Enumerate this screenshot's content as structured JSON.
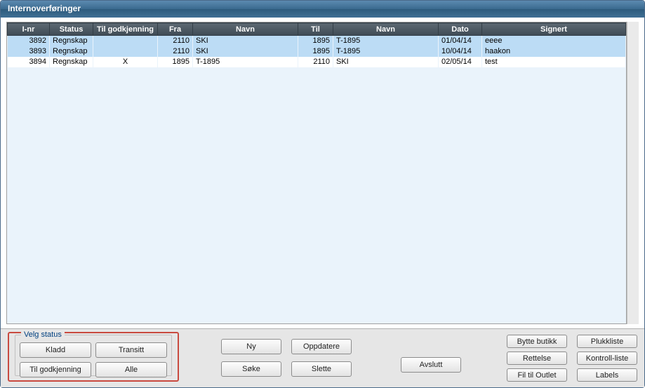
{
  "window": {
    "title": "Internoverføringer"
  },
  "grid": {
    "headers": [
      "I-nr",
      "Status",
      "Til godkjenning",
      "Fra",
      "Navn",
      "Til",
      "Navn",
      "Dato",
      "Signert"
    ],
    "rows": [
      {
        "inr": "3892",
        "status": "Regnskap",
        "tg": "",
        "fra": "2110",
        "navn1": "SKI",
        "til": "1895",
        "navn2": "T-1895",
        "dato": "01/04/14",
        "signert": "eeee",
        "cls": "sel"
      },
      {
        "inr": "3893",
        "status": "Regnskap",
        "tg": "",
        "fra": "2110",
        "navn1": "SKI",
        "til": "1895",
        "navn2": "T-1895",
        "dato": "10/04/14",
        "signert": "haakon",
        "cls": "sel"
      },
      {
        "inr": "3894",
        "status": "Regnskap",
        "tg": "X",
        "fra": "1895",
        "navn1": "T-1895",
        "til": "2110",
        "navn2": "SKI",
        "dato": "02/05/14",
        "signert": "test",
        "cls": "norm"
      }
    ]
  },
  "velg": {
    "legend": "Velg status",
    "kladd": "Kladd",
    "transitt": "Transitt",
    "til_godkjenning": "Til godkjenning",
    "alle": "Alle"
  },
  "buttons": {
    "ny": "Ny",
    "soke": "Søke",
    "oppdatere": "Oppdatere",
    "slette": "Slette",
    "avslutt": "Avslutt",
    "bytte_butikk": "Bytte butikk",
    "rettelse": "Rettelse",
    "fil_til_outlet": "Fil til Outlet",
    "plukkliste": "Plukkliste",
    "kontroll_liste": "Kontroll-liste",
    "labels": "Labels"
  }
}
